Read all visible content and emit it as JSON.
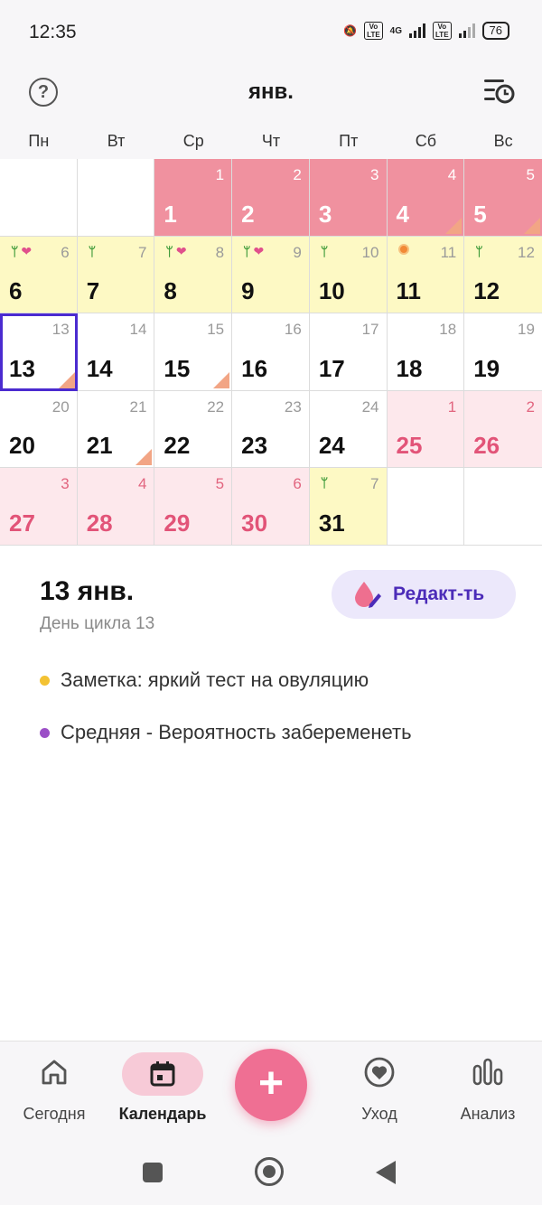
{
  "status": {
    "time": "12:35",
    "battery": "76",
    "network": "4G"
  },
  "header": {
    "title": "янв."
  },
  "weekdays": [
    "Пн",
    "Вт",
    "Ср",
    "Чт",
    "Пт",
    "Сб",
    "Вс"
  ],
  "detail": {
    "date": "13 янв.",
    "cycle_day": "День цикла 13",
    "edit_label": "Редакт-ть",
    "items": [
      {
        "text": "Заметка: яркий тест на овуляцию",
        "color": "#f3c233"
      },
      {
        "text": "Средняя - Вероятность забеременеть",
        "color": "#9b4fc7"
      }
    ]
  },
  "nav": {
    "today": "Сегодня",
    "calendar": "Календарь",
    "care": "Уход",
    "analysis": "Анализ"
  },
  "colors": {
    "period": "#f0919f",
    "fertile": "#fdf9c4",
    "predicted": "#fde8ec",
    "accent": "#ef6f93",
    "selected": "#4b2bd0"
  },
  "calendar": {
    "selected_day": "13",
    "rows": [
      [
        {
          "small": "",
          "big": "",
          "type": "empty",
          "marks": [],
          "note": false
        },
        {
          "small": "",
          "big": "",
          "type": "empty",
          "marks": [],
          "note": false
        },
        {
          "small": "1",
          "big": "1",
          "type": "period",
          "marks": [],
          "note": false
        },
        {
          "small": "2",
          "big": "2",
          "type": "period",
          "marks": [],
          "note": false
        },
        {
          "small": "3",
          "big": "3",
          "type": "period",
          "marks": [],
          "note": false
        },
        {
          "small": "4",
          "big": "4",
          "type": "period",
          "marks": [],
          "note": true
        },
        {
          "small": "5",
          "big": "5",
          "type": "period",
          "marks": [],
          "note": true
        }
      ],
      [
        {
          "small": "6",
          "big": "6",
          "type": "fertile",
          "marks": [
            "sprout",
            "heart"
          ],
          "note": false
        },
        {
          "small": "7",
          "big": "7",
          "type": "fertile",
          "marks": [
            "sprout"
          ],
          "note": false
        },
        {
          "small": "8",
          "big": "8",
          "type": "fertile",
          "marks": [
            "sprout",
            "heart"
          ],
          "note": false
        },
        {
          "small": "9",
          "big": "9",
          "type": "fertile",
          "marks": [
            "sprout",
            "heart"
          ],
          "note": false
        },
        {
          "small": "10",
          "big": "10",
          "type": "fertile",
          "marks": [
            "sprout"
          ],
          "note": false
        },
        {
          "small": "11",
          "big": "11",
          "type": "fertile",
          "marks": [
            "ovulation"
          ],
          "note": false
        },
        {
          "small": "12",
          "big": "12",
          "type": "fertile",
          "marks": [
            "sprout"
          ],
          "note": false
        }
      ],
      [
        {
          "small": "13",
          "big": "13",
          "type": "normal",
          "marks": [],
          "note": true,
          "selected": true
        },
        {
          "small": "14",
          "big": "14",
          "type": "normal",
          "marks": [],
          "note": false
        },
        {
          "small": "15",
          "big": "15",
          "type": "normal",
          "marks": [],
          "note": true
        },
        {
          "small": "16",
          "big": "16",
          "type": "normal",
          "marks": [],
          "note": false
        },
        {
          "small": "17",
          "big": "17",
          "type": "normal",
          "marks": [],
          "note": false
        },
        {
          "small": "18",
          "big": "18",
          "type": "normal",
          "marks": [],
          "note": false
        },
        {
          "small": "19",
          "big": "19",
          "type": "normal",
          "marks": [],
          "note": false
        }
      ],
      [
        {
          "small": "20",
          "big": "20",
          "type": "normal",
          "marks": [],
          "note": false
        },
        {
          "small": "21",
          "big": "21",
          "type": "normal",
          "marks": [],
          "note": true
        },
        {
          "small": "22",
          "big": "22",
          "type": "normal",
          "marks": [],
          "note": false
        },
        {
          "small": "23",
          "big": "23",
          "type": "normal",
          "marks": [],
          "note": false
        },
        {
          "small": "24",
          "big": "24",
          "type": "normal",
          "marks": [],
          "note": false
        },
        {
          "small": "1",
          "big": "25",
          "type": "pred",
          "marks": [],
          "note": false
        },
        {
          "small": "2",
          "big": "26",
          "type": "pred",
          "marks": [],
          "note": false
        }
      ],
      [
        {
          "small": "3",
          "big": "27",
          "type": "pred",
          "marks": [],
          "note": false
        },
        {
          "small": "4",
          "big": "28",
          "type": "pred",
          "marks": [],
          "note": false
        },
        {
          "small": "5",
          "big": "29",
          "type": "pred",
          "marks": [],
          "note": false
        },
        {
          "small": "6",
          "big": "30",
          "type": "pred",
          "marks": [],
          "note": false
        },
        {
          "small": "7",
          "big": "31",
          "type": "fertile",
          "marks": [
            "sprout"
          ],
          "note": false
        },
        {
          "small": "",
          "big": "",
          "type": "empty",
          "marks": [],
          "note": false
        },
        {
          "small": "",
          "big": "",
          "type": "empty",
          "marks": [],
          "note": false
        }
      ]
    ]
  }
}
